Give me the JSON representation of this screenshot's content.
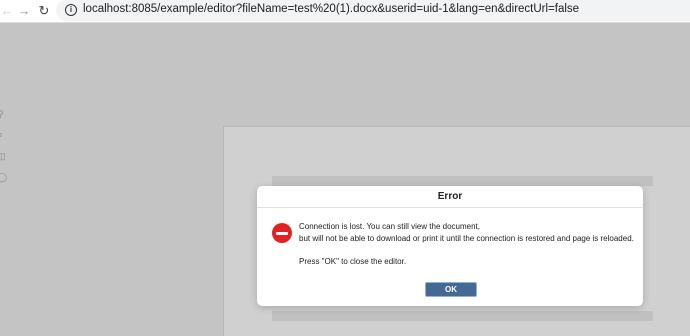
{
  "browser": {
    "url": "localhost:8085/example/editor?fileName=test%20(1).docx&userid=uid-1&lang=en&directUrl=false",
    "icons": [
      "back-icon",
      "forward-icon",
      "reload-icon",
      "info-icon"
    ]
  },
  "sidebar": {
    "icons": [
      "search-icon",
      "headings-icon",
      "columns-icon",
      "comments-icon"
    ]
  },
  "dialog": {
    "title": "Error",
    "message_line1": "Connection is lost. You can still view the document,",
    "message_line2": "but will not be able to download or print it until the connection is restored and page is reloaded.",
    "message_line3": "Press \"OK\" to close the editor.",
    "ok_label": "OK",
    "icon": "stop-icon"
  },
  "colors": {
    "overlay": "#c4c4c4",
    "error_icon": "#e22222",
    "ok_button": "#446995"
  }
}
